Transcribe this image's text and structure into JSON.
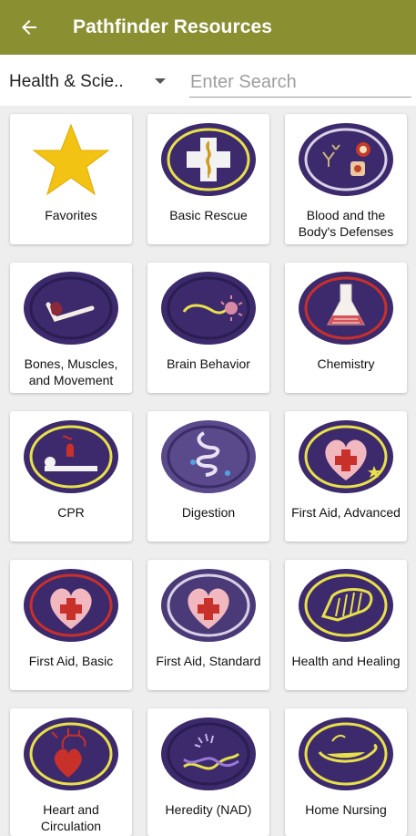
{
  "appbar": {
    "title": "Pathfinder Resources",
    "back_icon": "arrow-left-icon"
  },
  "filter": {
    "category": "Health & Scie..",
    "search_placeholder": "Enter Search"
  },
  "colors": {
    "primary": "#8a8f32",
    "patch_purple": "#3c2a6c",
    "patch_yellow": "#e8e04a",
    "patch_red": "#c8302a"
  },
  "items": [
    {
      "label": "Favorites",
      "icon": "star-icon"
    },
    {
      "label": "Basic Rescue",
      "icon": "basic-rescue-patch-icon"
    },
    {
      "label": "Blood and the Body's Defenses",
      "icon": "blood-defenses-patch-icon"
    },
    {
      "label": "Bones, Muscles, and Movement",
      "icon": "bones-muscles-patch-icon"
    },
    {
      "label": "Brain Behavior",
      "icon": "brain-behavior-patch-icon"
    },
    {
      "label": "Chemistry",
      "icon": "chemistry-patch-icon"
    },
    {
      "label": "CPR",
      "icon": "cpr-patch-icon"
    },
    {
      "label": "Digestion",
      "icon": "digestion-patch-icon"
    },
    {
      "label": "First Aid, Advanced",
      "icon": "first-aid-advanced-patch-icon"
    },
    {
      "label": "First Aid, Basic",
      "icon": "first-aid-basic-patch-icon"
    },
    {
      "label": "First Aid, Standard",
      "icon": "first-aid-standard-patch-icon"
    },
    {
      "label": "Health and Healing",
      "icon": "health-healing-patch-icon"
    },
    {
      "label": "Heart and Circulation",
      "icon": "heart-circulation-patch-icon"
    },
    {
      "label": "Heredity (NAD)",
      "icon": "heredity-patch-icon"
    },
    {
      "label": "Home Nursing",
      "icon": "home-nursing-patch-icon"
    }
  ]
}
